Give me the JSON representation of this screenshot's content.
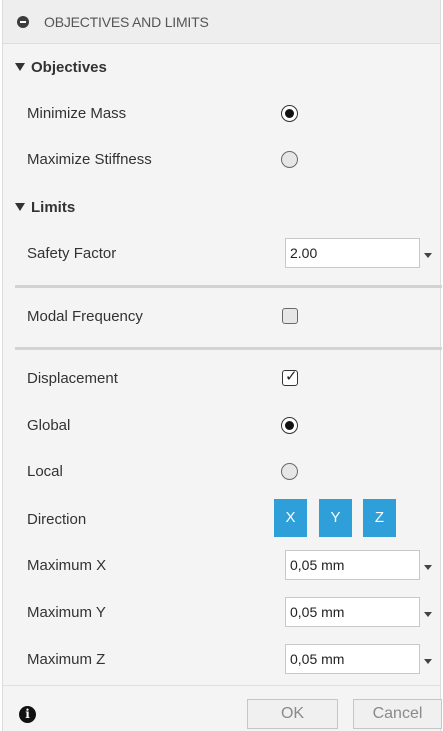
{
  "header": {
    "title": "OBJECTIVES AND LIMITS",
    "icon": "collapse-icon"
  },
  "objectives": {
    "title": "Objectives",
    "minimize_mass": {
      "label": "Minimize Mass",
      "selected": true
    },
    "maximize_stiffness": {
      "label": "Maximize Stiffness",
      "selected": false
    }
  },
  "limits": {
    "title": "Limits",
    "safety_factor": {
      "label": "Safety Factor",
      "value": "2.00"
    },
    "modal_frequency": {
      "label": "Modal Frequency",
      "checked": false
    },
    "displacement": {
      "label": "Displacement",
      "checked": true
    },
    "global": {
      "label": "Global",
      "selected": true
    },
    "local": {
      "label": "Local",
      "selected": false
    },
    "direction": {
      "label": "Direction",
      "buttons": [
        "X",
        "Y",
        "Z"
      ]
    },
    "maximum_x": {
      "label": "Maximum X",
      "value": "0,05 mm"
    },
    "maximum_y": {
      "label": "Maximum Y",
      "value": "0,05 mm"
    },
    "maximum_z": {
      "label": "Maximum Z",
      "value": "0,05 mm"
    }
  },
  "footer": {
    "ok_label": "OK",
    "cancel_label": "Cancel",
    "info_icon": "info-icon"
  },
  "colors": {
    "accent": "#2f9fd9",
    "panel_background": "#f4f4f4"
  }
}
